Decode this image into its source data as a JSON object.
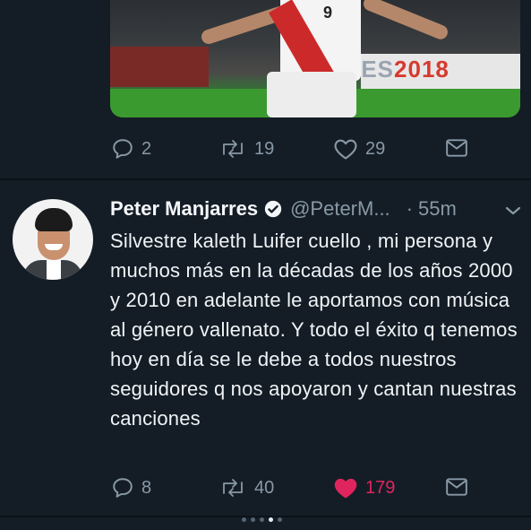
{
  "colors": {
    "background": "#141d26",
    "text_primary": "#f5f8fa",
    "text_secondary": "#8899a6",
    "like_active": "#e0245e"
  },
  "previous_tweet": {
    "media": {
      "banner_text_pre": "PES",
      "banner_text_year": "2018",
      "jersey_number": "9"
    },
    "actions": {
      "reply_count": "2",
      "retweet_count": "19",
      "like_count": "29"
    }
  },
  "tweet": {
    "display_name": "Peter Manjarres",
    "handle": "@PeterM...",
    "separator": "·",
    "timestamp": "55m",
    "text": "Silvestre kaleth Luifer cuello , mi persona y muchos más en la décadas de los años 2000 y 2010 en adelante le aportamos con música al género vallenato. Y todo el éxito q tenemos hoy en día se le debe a todos nuestros seguidores q nos apoyaron y cantan nuestras canciones",
    "actions": {
      "reply_count": "8",
      "retweet_count": "40",
      "like_count": "179",
      "liked": true
    }
  },
  "icons": {
    "reply": "reply-icon",
    "retweet": "retweet-icon",
    "like": "heart-icon",
    "message": "envelope-icon",
    "verified": "verified-badge-icon",
    "menu": "chevron-down-icon"
  },
  "carousel": {
    "total": 5,
    "active_index": 3
  }
}
